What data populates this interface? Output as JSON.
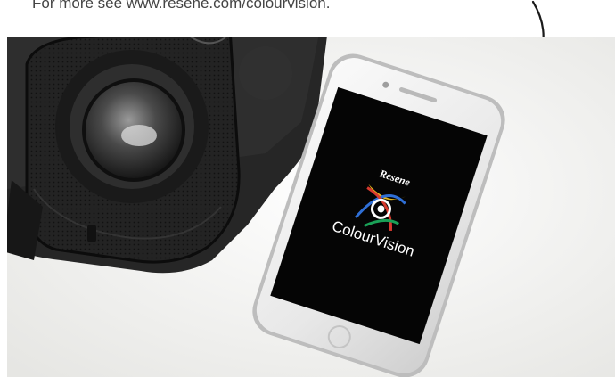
{
  "caption": {
    "text": "For more see www.resene.com/colourvision."
  },
  "phone_screen": {
    "brand": "Resene",
    "app_name": "ColourVision"
  },
  "colors": {
    "screen": "#050505",
    "headset": "#1e1e1e",
    "background": "#f3f3f1"
  },
  "icons": {
    "arrow": "hand-drawn-curved-arrow-icon",
    "logo": "resene-colourvision-logo-icon"
  }
}
